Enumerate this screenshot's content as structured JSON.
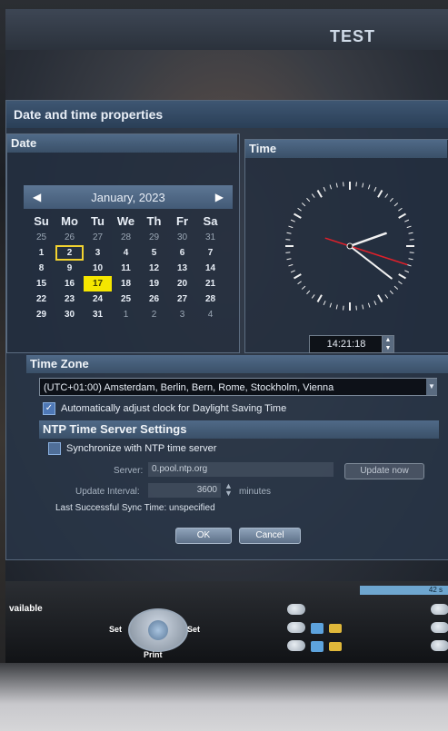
{
  "header": {
    "title": "TEST"
  },
  "dialog": {
    "title": "Date and time properties",
    "date_panel_label": "Date",
    "time_panel_label": "Time",
    "calendar": {
      "month_label": "January, 2023",
      "prev_icon": "chevron-left-icon",
      "next_icon": "chevron-right-icon",
      "weekdays": [
        "Su",
        "Mo",
        "Tu",
        "We",
        "Th",
        "Fr",
        "Sa"
      ],
      "weeks": [
        [
          "25",
          "26",
          "27",
          "28",
          "29",
          "30",
          "31"
        ],
        [
          "1",
          "2",
          "3",
          "4",
          "5",
          "6",
          "7"
        ],
        [
          "8",
          "9",
          "10",
          "11",
          "12",
          "13",
          "14"
        ],
        [
          "15",
          "16",
          "17",
          "18",
          "19",
          "20",
          "21"
        ],
        [
          "22",
          "23",
          "24",
          "25",
          "26",
          "27",
          "28"
        ],
        [
          "29",
          "30",
          "31",
          "1",
          "2",
          "3",
          "4"
        ]
      ],
      "selected_day": "2",
      "today_day": "17"
    },
    "time": {
      "value": "14:21:18",
      "clock_hour": 14,
      "clock_minute": 21,
      "clock_second": 18,
      "second_hand_color": "#e0202a"
    },
    "timezone": {
      "label": "Time Zone",
      "selected": "(UTC+01:00) Amsterdam, Berlin, Bern, Rome, Stockholm, Vienna",
      "dst_label": "Automatically adjust clock for Daylight Saving Time",
      "dst_checked": true
    },
    "ntp": {
      "label": "NTP Time Server Settings",
      "sync_label": "Synchronize with NTP time server",
      "sync_checked": false,
      "server_label": "Server:",
      "server_value": "0.pool.ntp.org",
      "update_now_label": "Update now",
      "interval_label": "Update Interval:",
      "interval_value": "3600",
      "interval_unit": "minutes",
      "last_sync_label": "Last Successful Sync Time: unspecified"
    },
    "ok_label": "OK",
    "cancel_label": "Cancel"
  },
  "bottom_panel": {
    "status_value": "42 s",
    "available_label": "vailable",
    "set_left_label": "Set",
    "set_right_label": "Set",
    "print_label": "Print"
  }
}
